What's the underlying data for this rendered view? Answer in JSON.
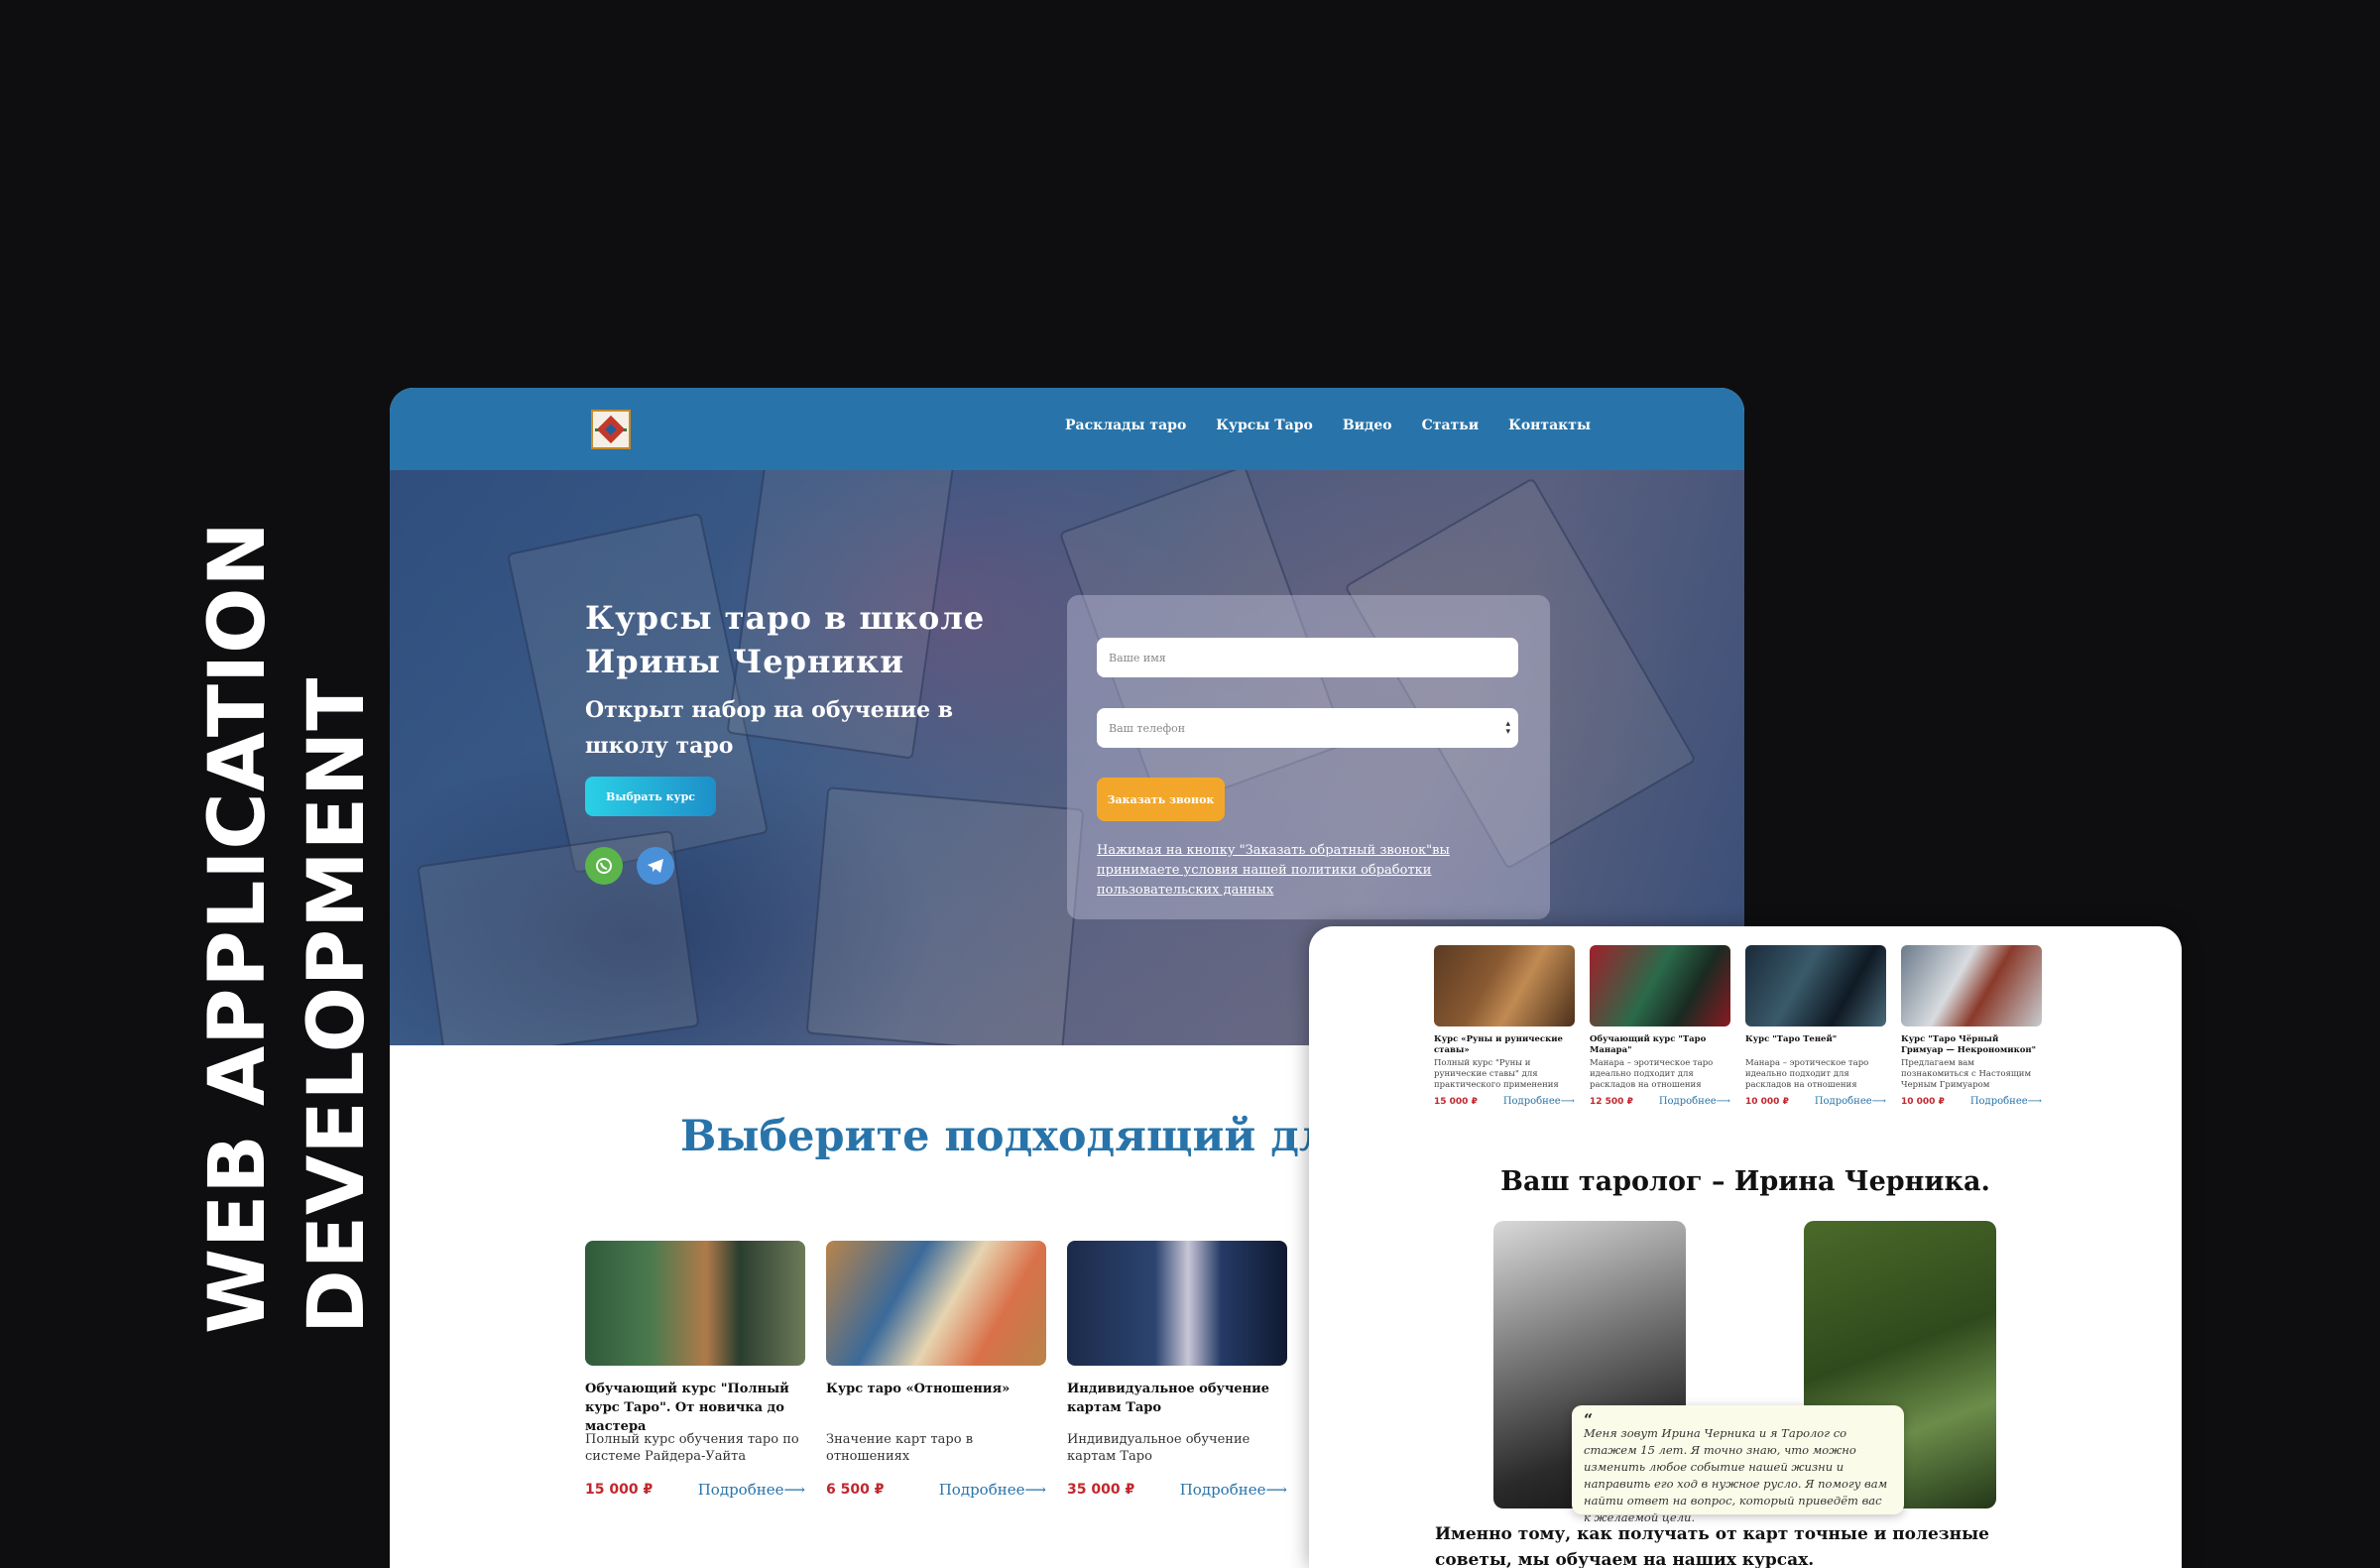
{
  "title": {
    "line1": "WEB APPLICATION",
    "line2": "DEVELOPMENT"
  },
  "nav": {
    "items": [
      "Расклады таро",
      "Курсы Таро",
      "Видео",
      "Статьи",
      "Контакты"
    ]
  },
  "hero": {
    "title": "Курсы таро в школе Ирины Черники",
    "subtitle": "Открыт набор на обучение в школу таро",
    "button": "Выбрать курс"
  },
  "form": {
    "name_placeholder": "Ваше имя",
    "phone_placeholder": "Ваш телефон",
    "button": "Заказать звонок",
    "policy": "Нажимая на кнопку \"Заказать обратный звонок\"вы принимаете условия нашей политики обработки пользовательских данных"
  },
  "section_title": "Выберите подходящий для ва",
  "courses": [
    {
      "title": "Обучающий курс \"Полный курс Таро\". От новичка до мастера",
      "desc": "Полный курс обучения таро по системе Райдера-Уайта",
      "price": "15 000 ₽",
      "more": "Подробнее⟶"
    },
    {
      "title": "Курс таро «Отношения»",
      "desc": "Значение карт таро в отношениях",
      "price": "6 500 ₽",
      "more": "Подробнее⟶"
    },
    {
      "title": "Индивидуальное обучение картам Таро",
      "desc": "Индивидуальное обучение картам Таро",
      "price": "35 000 ₽",
      "more": "Подробнее⟶"
    }
  ],
  "side": {
    "courses": [
      {
        "title": "Курс «Руны и рунические ставы»",
        "desc": "Полный курс \"Руны и рунические ставы\" для практического применения",
        "price": "15 000 ₽",
        "more": "Подробнее⟶"
      },
      {
        "title": "Обучающий курс \"Таро Манара\"",
        "desc": "Манара – эротическое таро идеально подходит для раскладов на отношения",
        "price": "12 500 ₽",
        "more": "Подробнее⟶"
      },
      {
        "title": "Курс \"Таро Теней\"",
        "desc": "Манара – эротическое таро идеально подходит для раскладов на отношения",
        "price": "10 000 ₽",
        "more": "Подробнее⟶"
      },
      {
        "title": "Курс \"Таро Чёрный Гримуар — Некрономикон\"",
        "desc": "Предлагаем вам познакомиться с Настоящим Черным Гримуаром",
        "price": "10 000 ₽",
        "more": "Подробнее⟶"
      }
    ],
    "title": "Ваш таролог – Ирина Черника.",
    "quote_mark": "“",
    "quote": "Меня зовут Ирина Черника и я Таролог со стажем 15 лет. Я точно знаю, что можно изменить любое событие нашей жизни и направить его ход в нужное русло. Я помогу вам найти ответ на вопрос, который приведёт вас к желаемой цели.",
    "bottom": "Именно тому, как получать от карт точные и полезные советы, мы обучаем на наших курсах."
  }
}
